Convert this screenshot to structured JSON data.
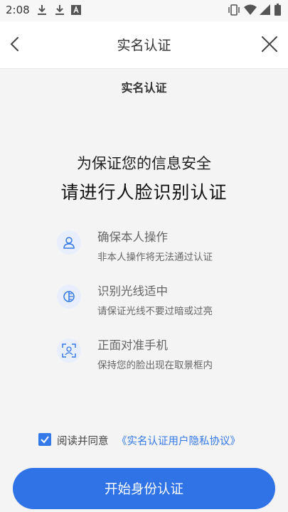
{
  "status_bar": {
    "time": "2:08",
    "left_icons": [
      "download-icon",
      "download-icon",
      "a-badge-icon"
    ],
    "right_icons": [
      "vibrate-icon",
      "wifi-icon",
      "signal-icon",
      "battery-icon"
    ]
  },
  "nav": {
    "title": "实名认证",
    "back_icon": "chevron-left-icon",
    "close_icon": "close-icon"
  },
  "main": {
    "section_title": "实名认证",
    "headline_line1": "为保证您的信息安全",
    "headline_line2": "请进行人脸识别认证",
    "tips": [
      {
        "icon": "person-icon",
        "title": "确保本人操作",
        "desc": "非本人操作将无法通过认证"
      },
      {
        "icon": "brightness-icon",
        "title": "识别光线适中",
        "desc": "请保证光线不要过暗或过亮"
      },
      {
        "icon": "face-scan-icon",
        "title": "正面对准手机",
        "desc": "保持您的脸出现在取景框内"
      }
    ]
  },
  "agreement": {
    "checked": true,
    "text": "阅读并同意",
    "link": "《实名认证用户隐私协议》"
  },
  "button": {
    "label": "开始身份认证"
  },
  "colors": {
    "accent": "#2f73e6",
    "link": "#3479e8",
    "background": "#f4f4f4",
    "icon_bg": "#e8eefb"
  }
}
